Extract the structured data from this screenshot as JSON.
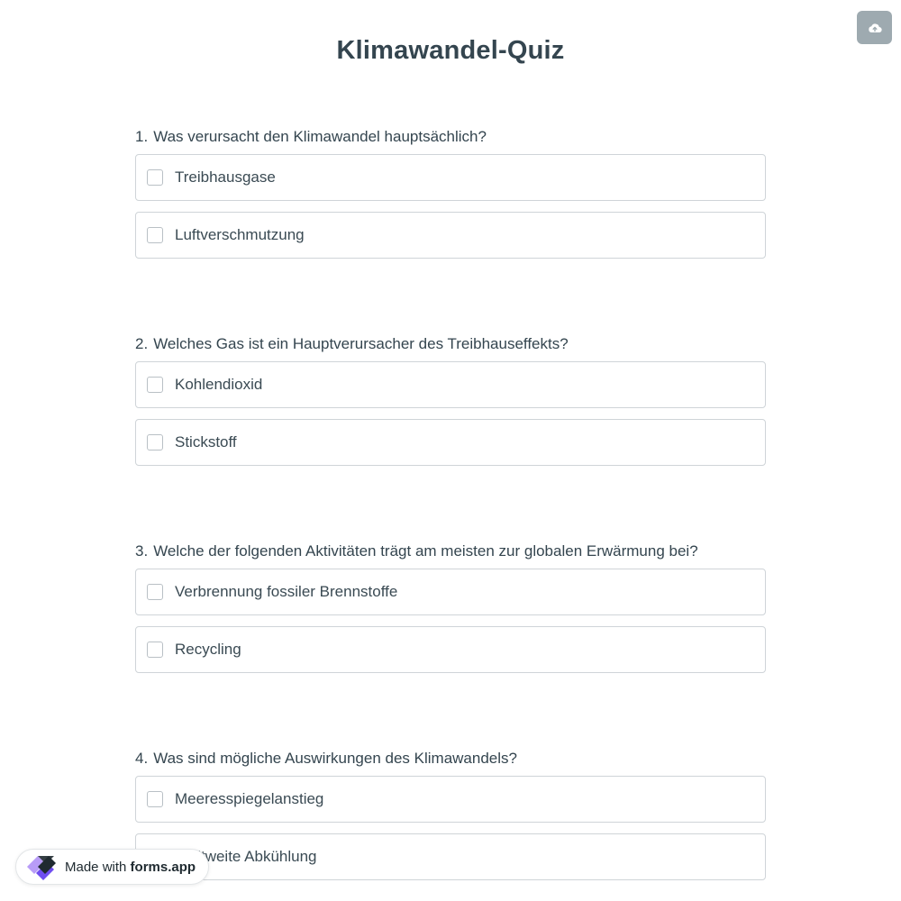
{
  "form": {
    "title": "Klimawandel-Quiz"
  },
  "questions": [
    {
      "number": "1.",
      "text": "Was verursacht den Klimawandel hauptsächlich?",
      "options": [
        "Treibhausgase",
        "Luftverschmutzung"
      ]
    },
    {
      "number": "2.",
      "text": "Welches Gas ist ein Hauptverursacher des Treibhauseffekts?",
      "options": [
        "Kohlendioxid",
        "Stickstoff"
      ]
    },
    {
      "number": "3.",
      "text": "Welche der folgenden Aktivitäten trägt am meisten zur globalen Erwärmung bei?",
      "options": [
        "Verbrennung fossiler Brennstoffe",
        "Recycling"
      ]
    },
    {
      "number": "4.",
      "text": "Was sind mögliche Auswirkungen des Klimawandels?",
      "options": [
        "Meeresspiegelanstieg",
        "Weltweite Abkühlung"
      ]
    }
  ],
  "badge": {
    "prefix": "Made with",
    "brand": "forms.app"
  },
  "icons": {
    "upload": "cloud-upload-icon",
    "logo": "forms-app-logo"
  },
  "colors": {
    "accent": "#7b5cf0",
    "text": "#34454f",
    "border": "#cfd4d8",
    "upload_bg": "#9eaab0"
  }
}
